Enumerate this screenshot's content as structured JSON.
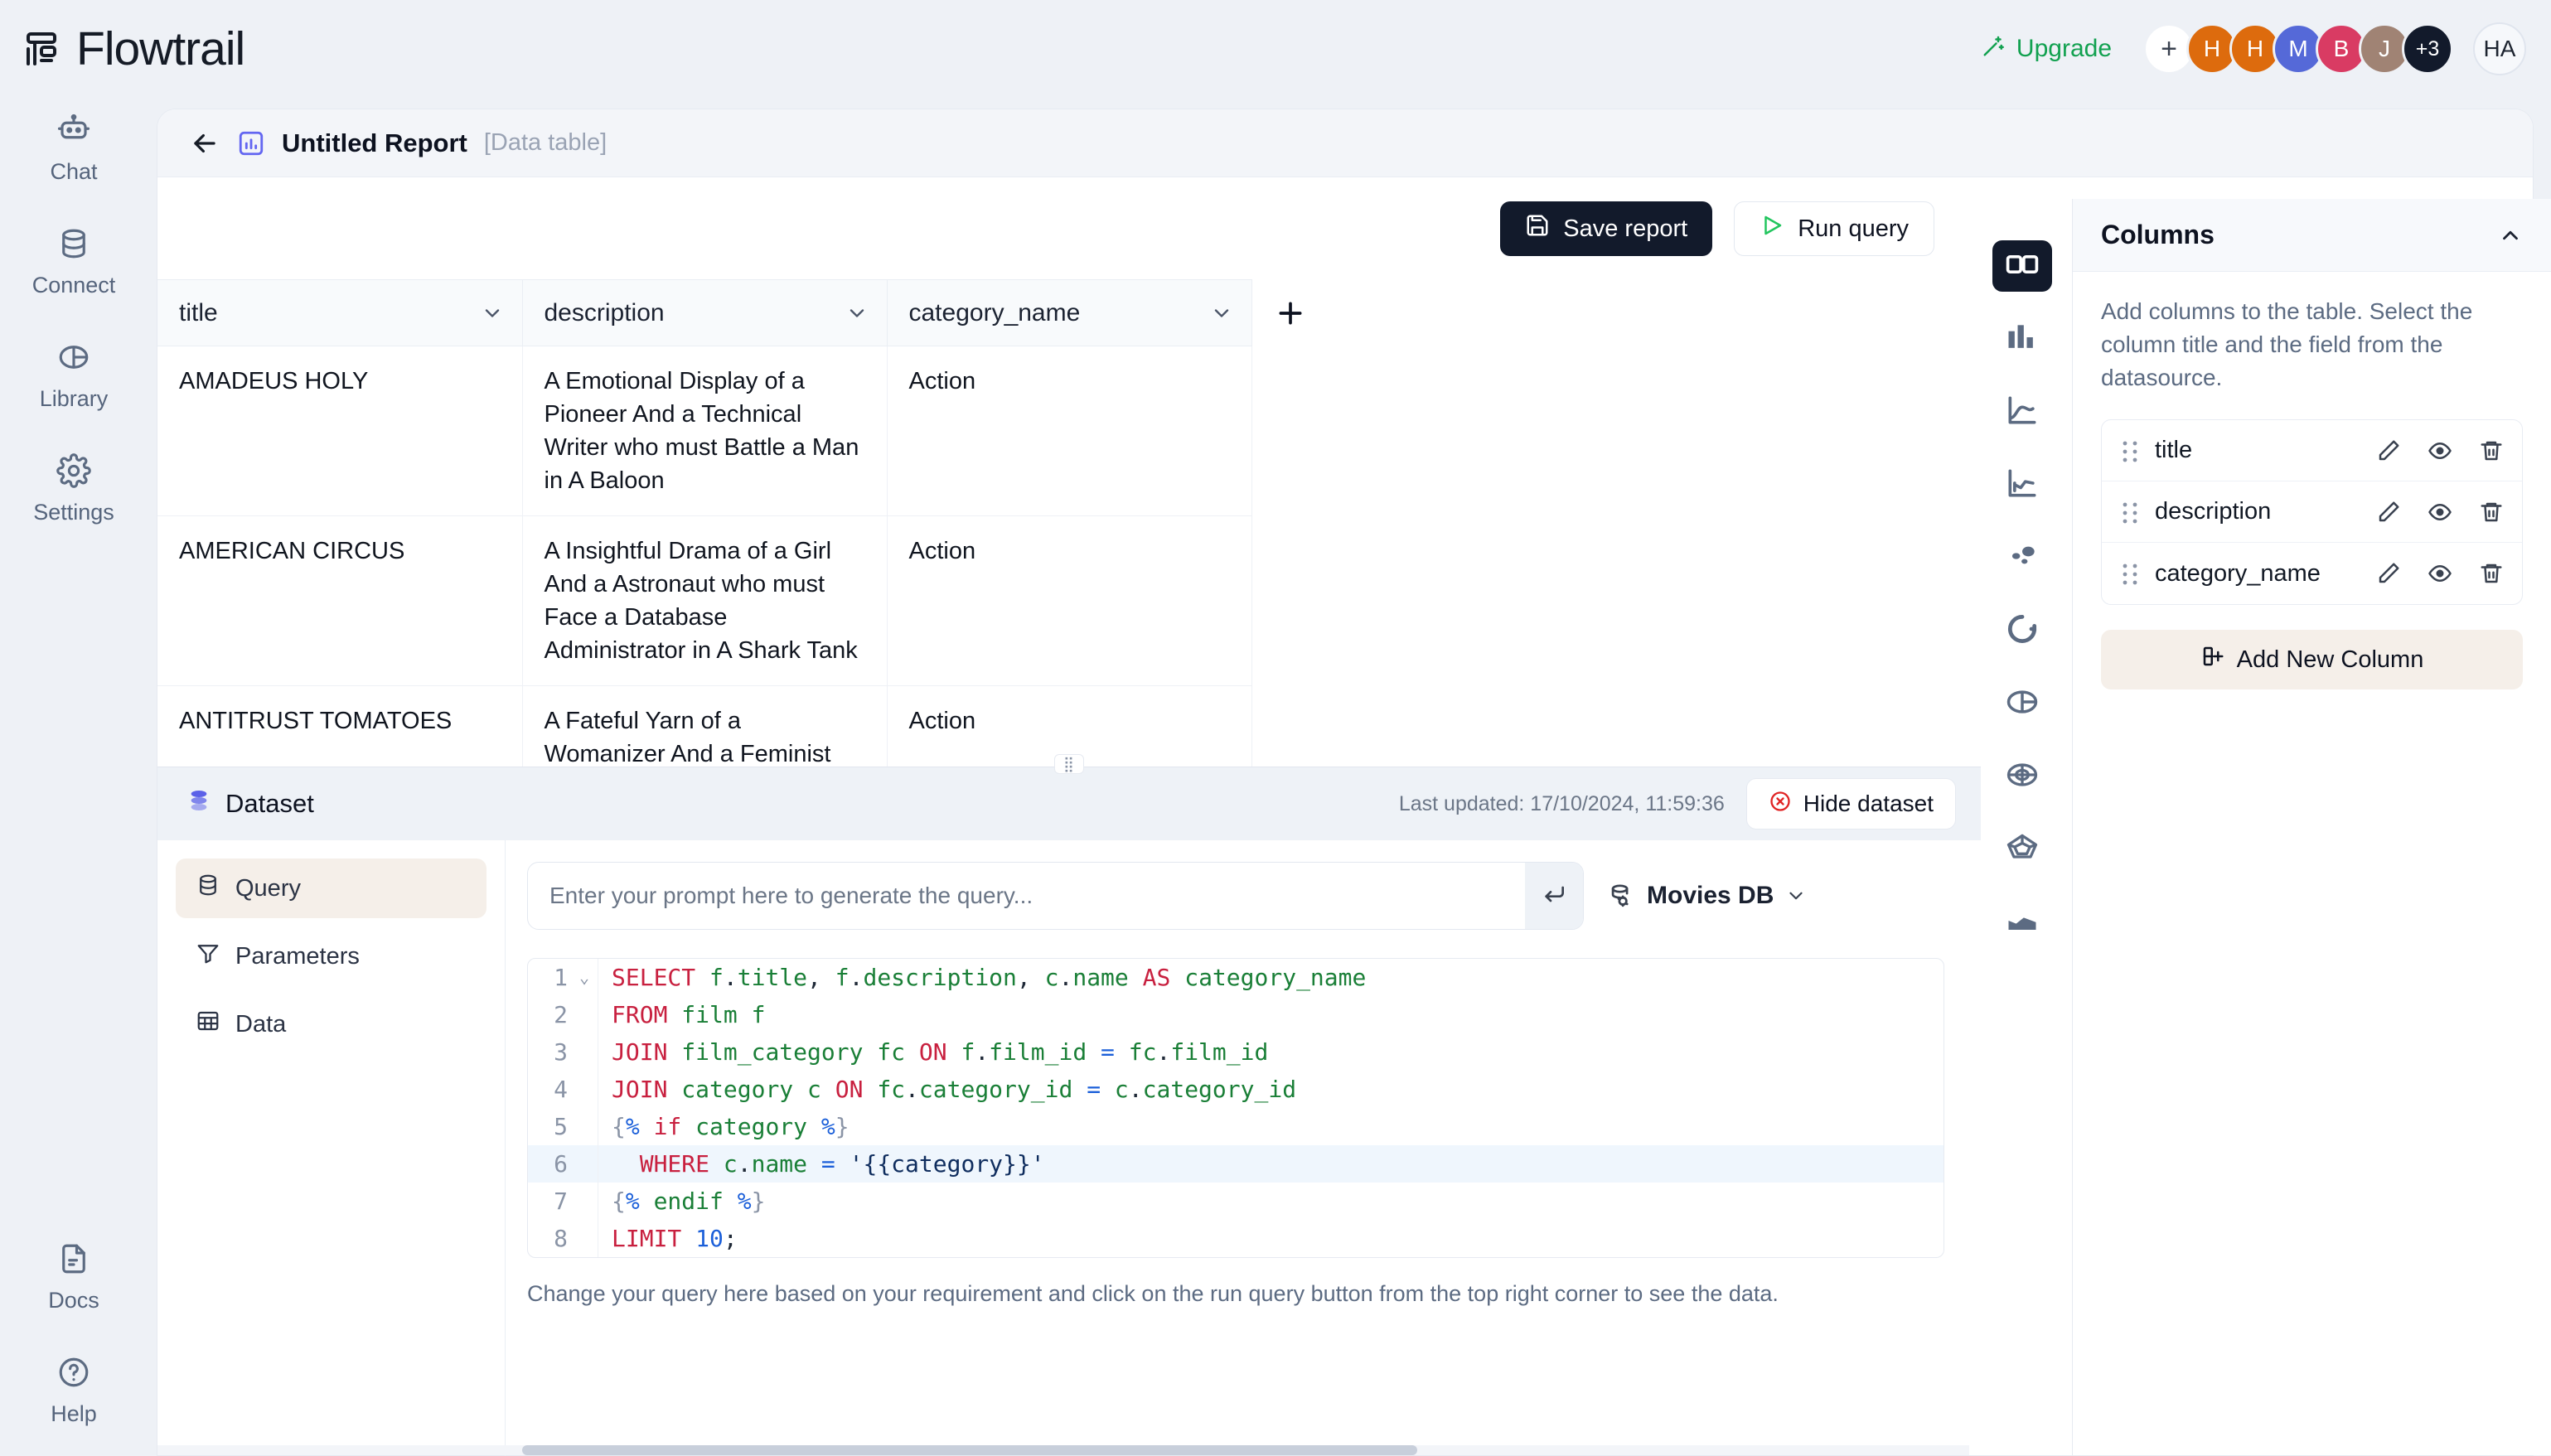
{
  "app": {
    "brand": "Flowtrail",
    "logo_icon": "flowtrail-logo-icon"
  },
  "topbar": {
    "upgrade_label": "Upgrade",
    "upgrade_icon": "magic-wand-icon",
    "add_member_label": "+",
    "avatars": [
      {
        "initial": "H",
        "color": "#DD6B0D"
      },
      {
        "initial": "H",
        "color": "#DD6B0D"
      },
      {
        "initial": "M",
        "color": "#5569D8"
      },
      {
        "initial": "B",
        "color": "#D93B63"
      },
      {
        "initial": "J",
        "color": "#A08374"
      }
    ],
    "overflow_label": "+3",
    "current_user_initials": "HA"
  },
  "sidebar": {
    "items": [
      {
        "label": "Chat",
        "icon": "robot-icon"
      },
      {
        "label": "Connect",
        "icon": "database-icon"
      },
      {
        "label": "Library",
        "icon": "pie-chart-icon"
      },
      {
        "label": "Settings",
        "icon": "gear-icon"
      }
    ],
    "bottom_items": [
      {
        "label": "Docs",
        "icon": "document-icon"
      },
      {
        "label": "Help",
        "icon": "question-circle-icon"
      }
    ]
  },
  "report": {
    "back_icon": "back-arrow-icon",
    "type_icon": "bar-chart-icon",
    "title": "Untitled Report",
    "subtitle": "[Data table]"
  },
  "toolbar": {
    "save_label": "Save report",
    "save_icon": "floppy-disk-icon",
    "run_label": "Run query",
    "run_icon": "play-icon"
  },
  "table": {
    "columns": [
      "title",
      "description",
      "category_name"
    ],
    "add_column_icon": "plus-icon",
    "rows": [
      {
        "title": "AMADEUS HOLY",
        "description": "A Emotional Display of a Pioneer And a Technical Writer who must Battle a Man in A Baloon",
        "category_name": "Action"
      },
      {
        "title": "AMERICAN CIRCUS",
        "description": "A Insightful Drama of a Girl And a Astronaut who must Face a Database Administrator in A Shark Tank",
        "category_name": "Action"
      },
      {
        "title": "ANTITRUST TOMATOES",
        "description": "A Fateful Yarn of a Womanizer And a Feminist who must",
        "category_name": "Action"
      }
    ]
  },
  "chart_types": [
    {
      "name": "table-view",
      "icon": "table-icon",
      "active": true
    },
    {
      "name": "bar-chart",
      "icon": "bar-chart-icon",
      "active": false
    },
    {
      "name": "line-chart",
      "icon": "line-chart-icon",
      "active": false
    },
    {
      "name": "area-line-chart",
      "icon": "area-line-chart-icon",
      "active": false
    },
    {
      "name": "scatter-chart",
      "icon": "scatter-chart-icon",
      "active": false
    },
    {
      "name": "donut-chart",
      "icon": "donut-chart-icon",
      "active": false
    },
    {
      "name": "pie-chart",
      "icon": "pie-chart-icon",
      "active": false
    },
    {
      "name": "radial-chart",
      "icon": "radial-chart-icon",
      "active": false
    },
    {
      "name": "radar-chart",
      "icon": "radar-chart-icon",
      "active": false
    },
    {
      "name": "area-chart",
      "icon": "area-chart-icon",
      "active": false
    }
  ],
  "columns_panel": {
    "title": "Columns",
    "collapse_icon": "chevron-up-icon",
    "description": "Add columns to the table. Select the column title and the field from the datasource.",
    "items": [
      {
        "name": "title"
      },
      {
        "name": "description"
      },
      {
        "name": "category_name"
      }
    ],
    "row_actions": [
      "edit-icon",
      "eye-icon",
      "trash-icon"
    ],
    "add_label": "Add New Column",
    "add_icon": "add-column-icon"
  },
  "dataset": {
    "title": "Dataset",
    "title_icon": "dataset-stack-icon",
    "last_updated": "Last updated: 17/10/2024, 11:59:36",
    "hide_label": "Hide dataset",
    "hide_icon": "close-circle-icon",
    "tabs": [
      {
        "label": "Query",
        "icon": "database-icon",
        "active": true
      },
      {
        "label": "Parameters",
        "icon": "funnel-icon",
        "active": false
      },
      {
        "label": "Data",
        "icon": "grid-icon",
        "active": false
      }
    ],
    "prompt_placeholder": "Enter your prompt here to generate the query...",
    "prompt_value": "",
    "send_icon": "enter-arrow-icon",
    "datasource_label": "Movies DB",
    "datasource_icon": "database-gear-icon",
    "datasource_chevron": "chevron-down-icon",
    "hint": "Change your query here based on your requirement and click on the run query button from the top right corner to see the data.",
    "query_lines": [
      "SELECT f.title, f.description, c.name AS category_name",
      "FROM film f",
      "JOIN film_category fc ON f.film_id = fc.film_id",
      "JOIN category c ON fc.category_id = c.category_id",
      "{% if category %}",
      "  WHERE c.name = '{{category}}'",
      "{% endif %}",
      "LIMIT 10;"
    ],
    "active_line": 6
  },
  "colors": {
    "accent_green": "#12a150",
    "brand_dark": "#121a2b",
    "report_icon": "#6366f1",
    "danger": "#e02424",
    "beige": "#f5efe9"
  }
}
